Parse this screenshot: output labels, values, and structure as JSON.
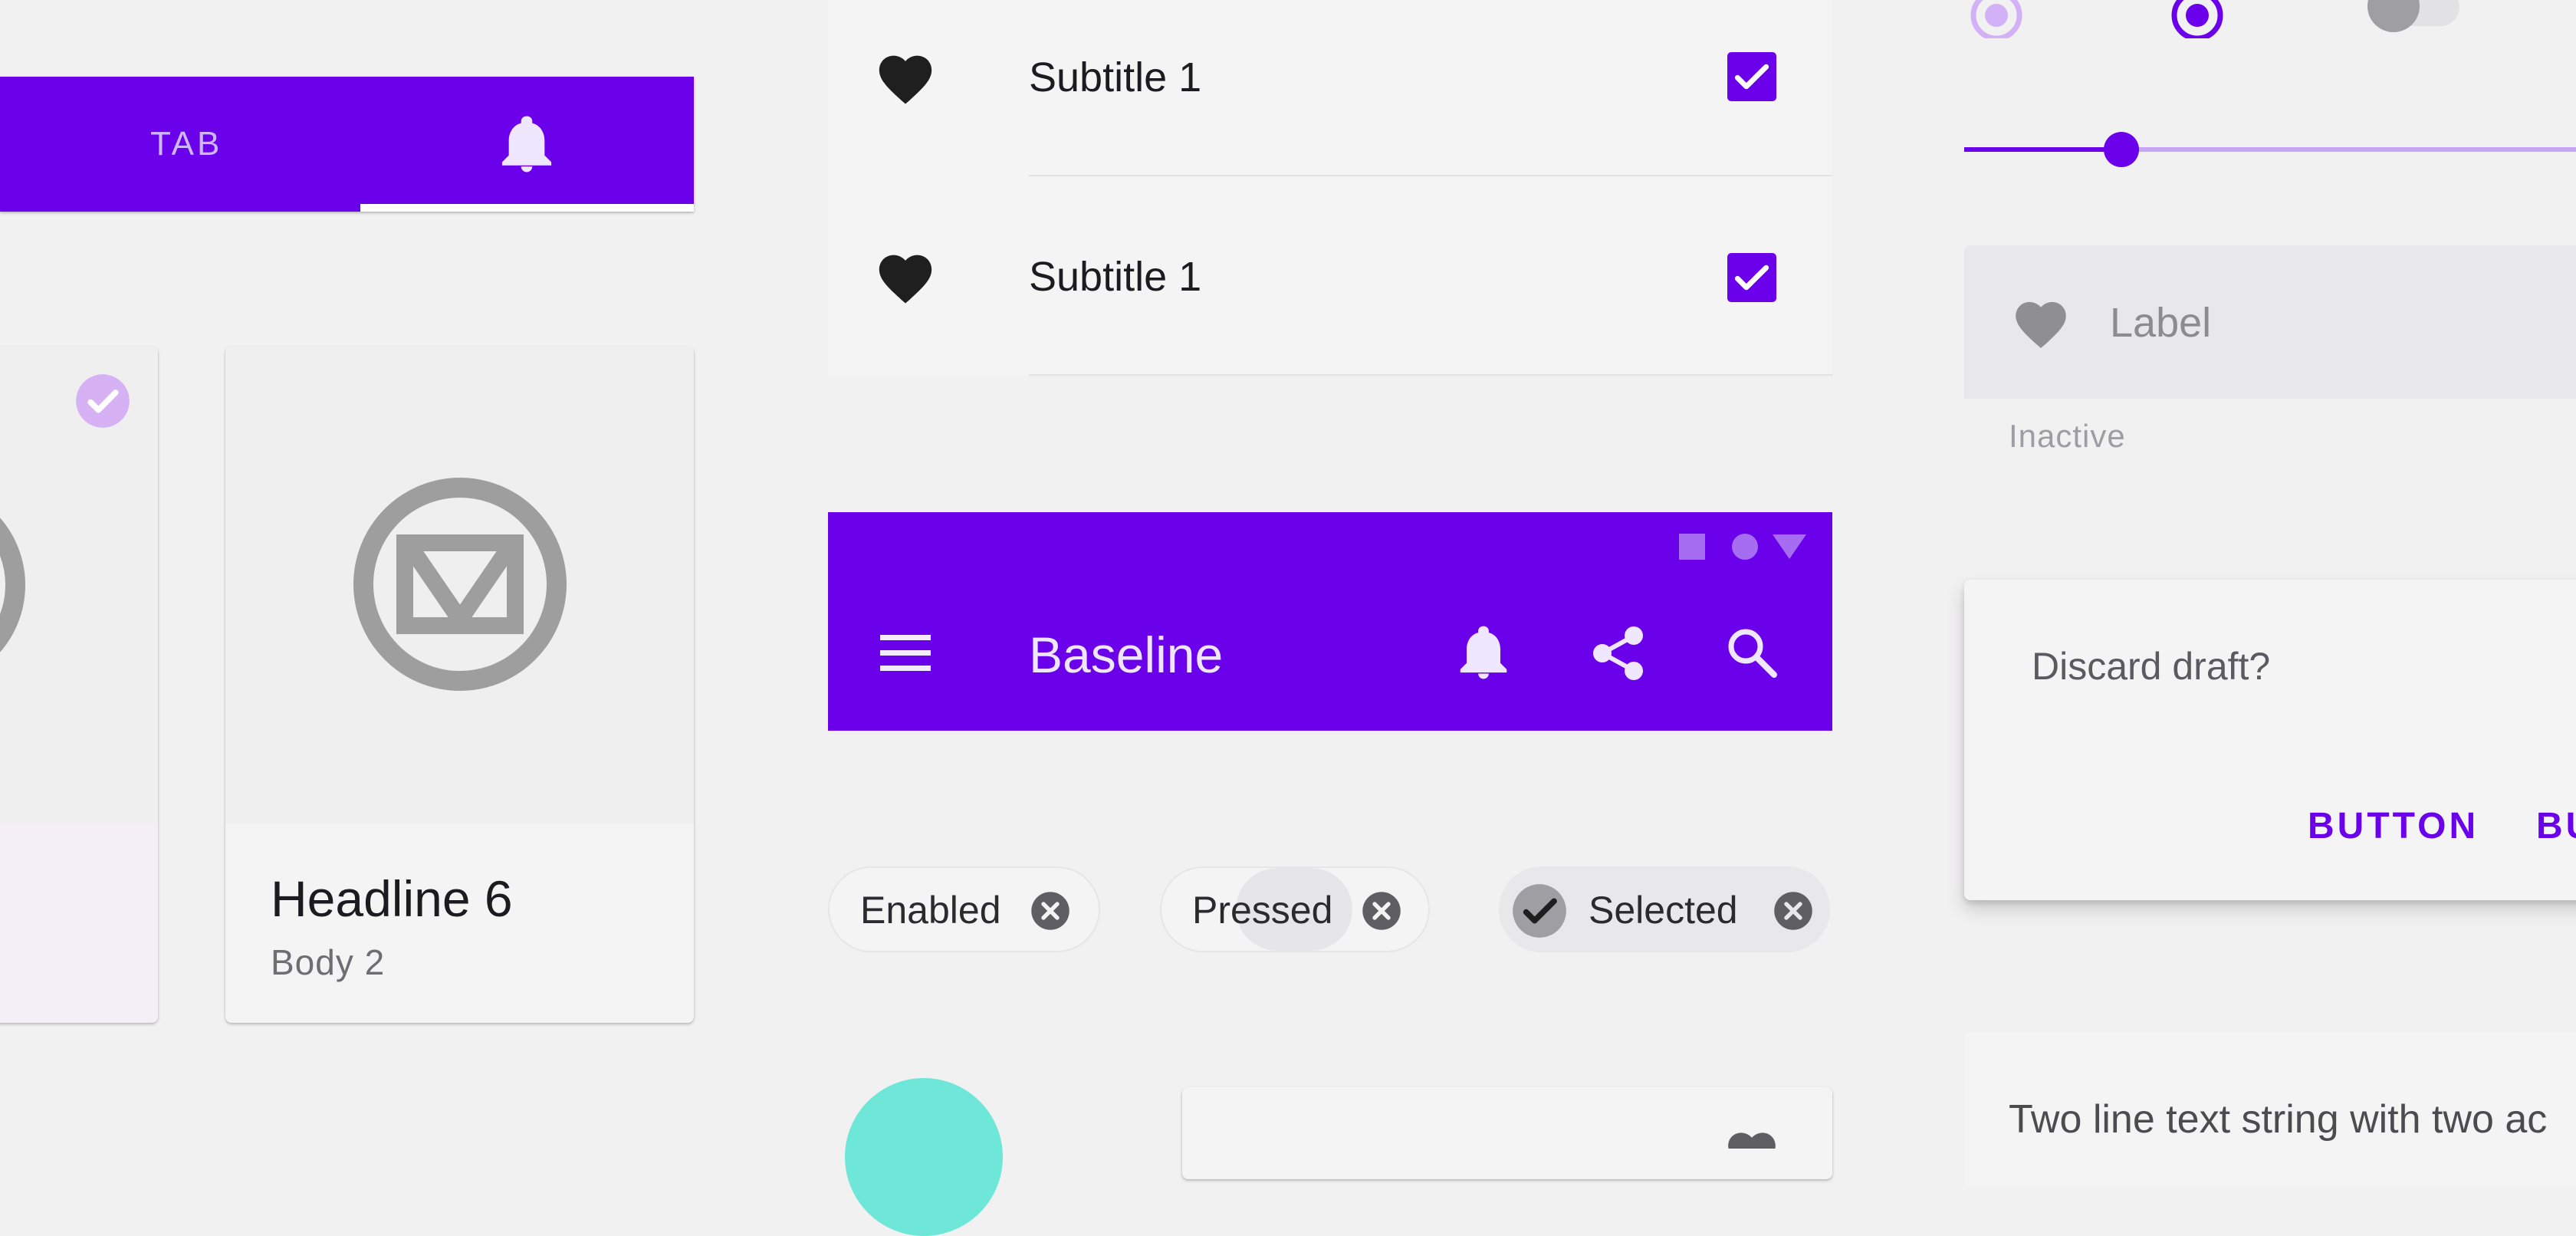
{
  "tabs": {
    "tab_label": "TAB",
    "active_icon": "bell-icon"
  },
  "cards": {
    "left": {
      "headline_fragment": "",
      "icon": "check-circle-icon"
    },
    "right": {
      "headline": "Headline 6",
      "body": "Body 2",
      "icon": "m-logo-icon"
    }
  },
  "list": {
    "items": [
      {
        "label": "Subtitle 1",
        "leading_icon": "heart-icon",
        "checked": true
      },
      {
        "label": "Subtitle 1",
        "leading_icon": "heart-icon",
        "checked": true
      }
    ]
  },
  "appbar": {
    "title": "Baseline",
    "status_icons": [
      "square-icon",
      "circle-icon",
      "triangle-icon"
    ],
    "actions": [
      "bell-icon",
      "share-icon",
      "search-icon"
    ],
    "nav_icon": "menu-icon"
  },
  "chips": {
    "enabled": "Enabled",
    "pressed": "Pressed",
    "selected": "Selected"
  },
  "controls": {
    "slider_value": 0.23
  },
  "text_field": {
    "label": "Label",
    "helper": "Inactive",
    "leading_icon": "heart-icon"
  },
  "dialog": {
    "text": "Discard draft?",
    "button_1": "BUTTON",
    "button_2": "BU"
  },
  "two_line": {
    "text": "Two line text string with two ac"
  },
  "colors": {
    "primary": "#6b00ea",
    "primary_light": "#c7a5f5",
    "secondary": "#6ee7d8",
    "background": "#f2f1f2",
    "surface": "#f4f4f5"
  }
}
